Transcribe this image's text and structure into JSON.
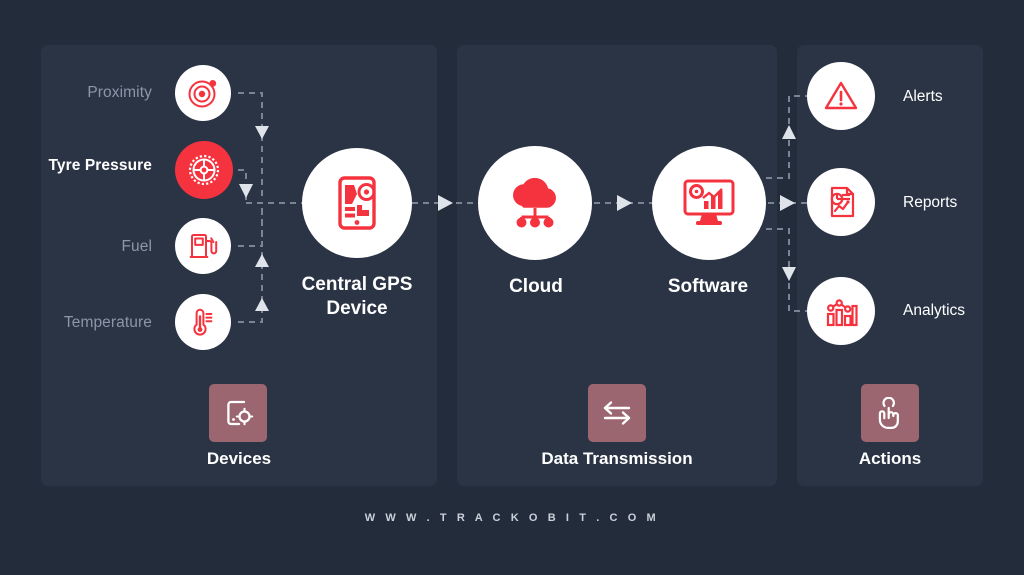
{
  "accent_color": "#f5333f",
  "background_color": "#232c3b",
  "panel_color": "#2a3445",
  "tile_color": "#9c6670",
  "muted_text_color": "#8d96a6",
  "sections": [
    {
      "id": "devices",
      "label": "Devices",
      "icon": "device-gear-icon"
    },
    {
      "id": "transmission",
      "label": "Data Transmission",
      "icon": "exchange-arrows-icon"
    },
    {
      "id": "actions",
      "label": "Actions",
      "icon": "tap-hand-icon"
    }
  ],
  "sensors": [
    {
      "label": "Proximity",
      "icon": "radar-target-icon",
      "active": false
    },
    {
      "label": "Tyre Pressure",
      "icon": "tyre-icon",
      "active": true
    },
    {
      "label": "Fuel",
      "icon": "fuel-pump-icon",
      "active": false
    },
    {
      "label": "Temperature",
      "icon": "thermometer-icon",
      "active": false
    }
  ],
  "nodes": [
    {
      "id": "central-gps",
      "label": "Central GPS\nDevice",
      "icon": "gps-device-icon"
    },
    {
      "id": "cloud",
      "label": "Cloud",
      "icon": "cloud-network-icon"
    },
    {
      "id": "software",
      "label": "Software",
      "icon": "software-dashboard-icon"
    }
  ],
  "outputs": [
    {
      "label": "Alerts",
      "icon": "warning-triangle-icon"
    },
    {
      "label": "Reports",
      "icon": "report-document-icon"
    },
    {
      "label": "Analytics",
      "icon": "bar-chart-icon"
    }
  ],
  "footer": {
    "url": "W W W . T R A C K O B I T . C O M"
  }
}
